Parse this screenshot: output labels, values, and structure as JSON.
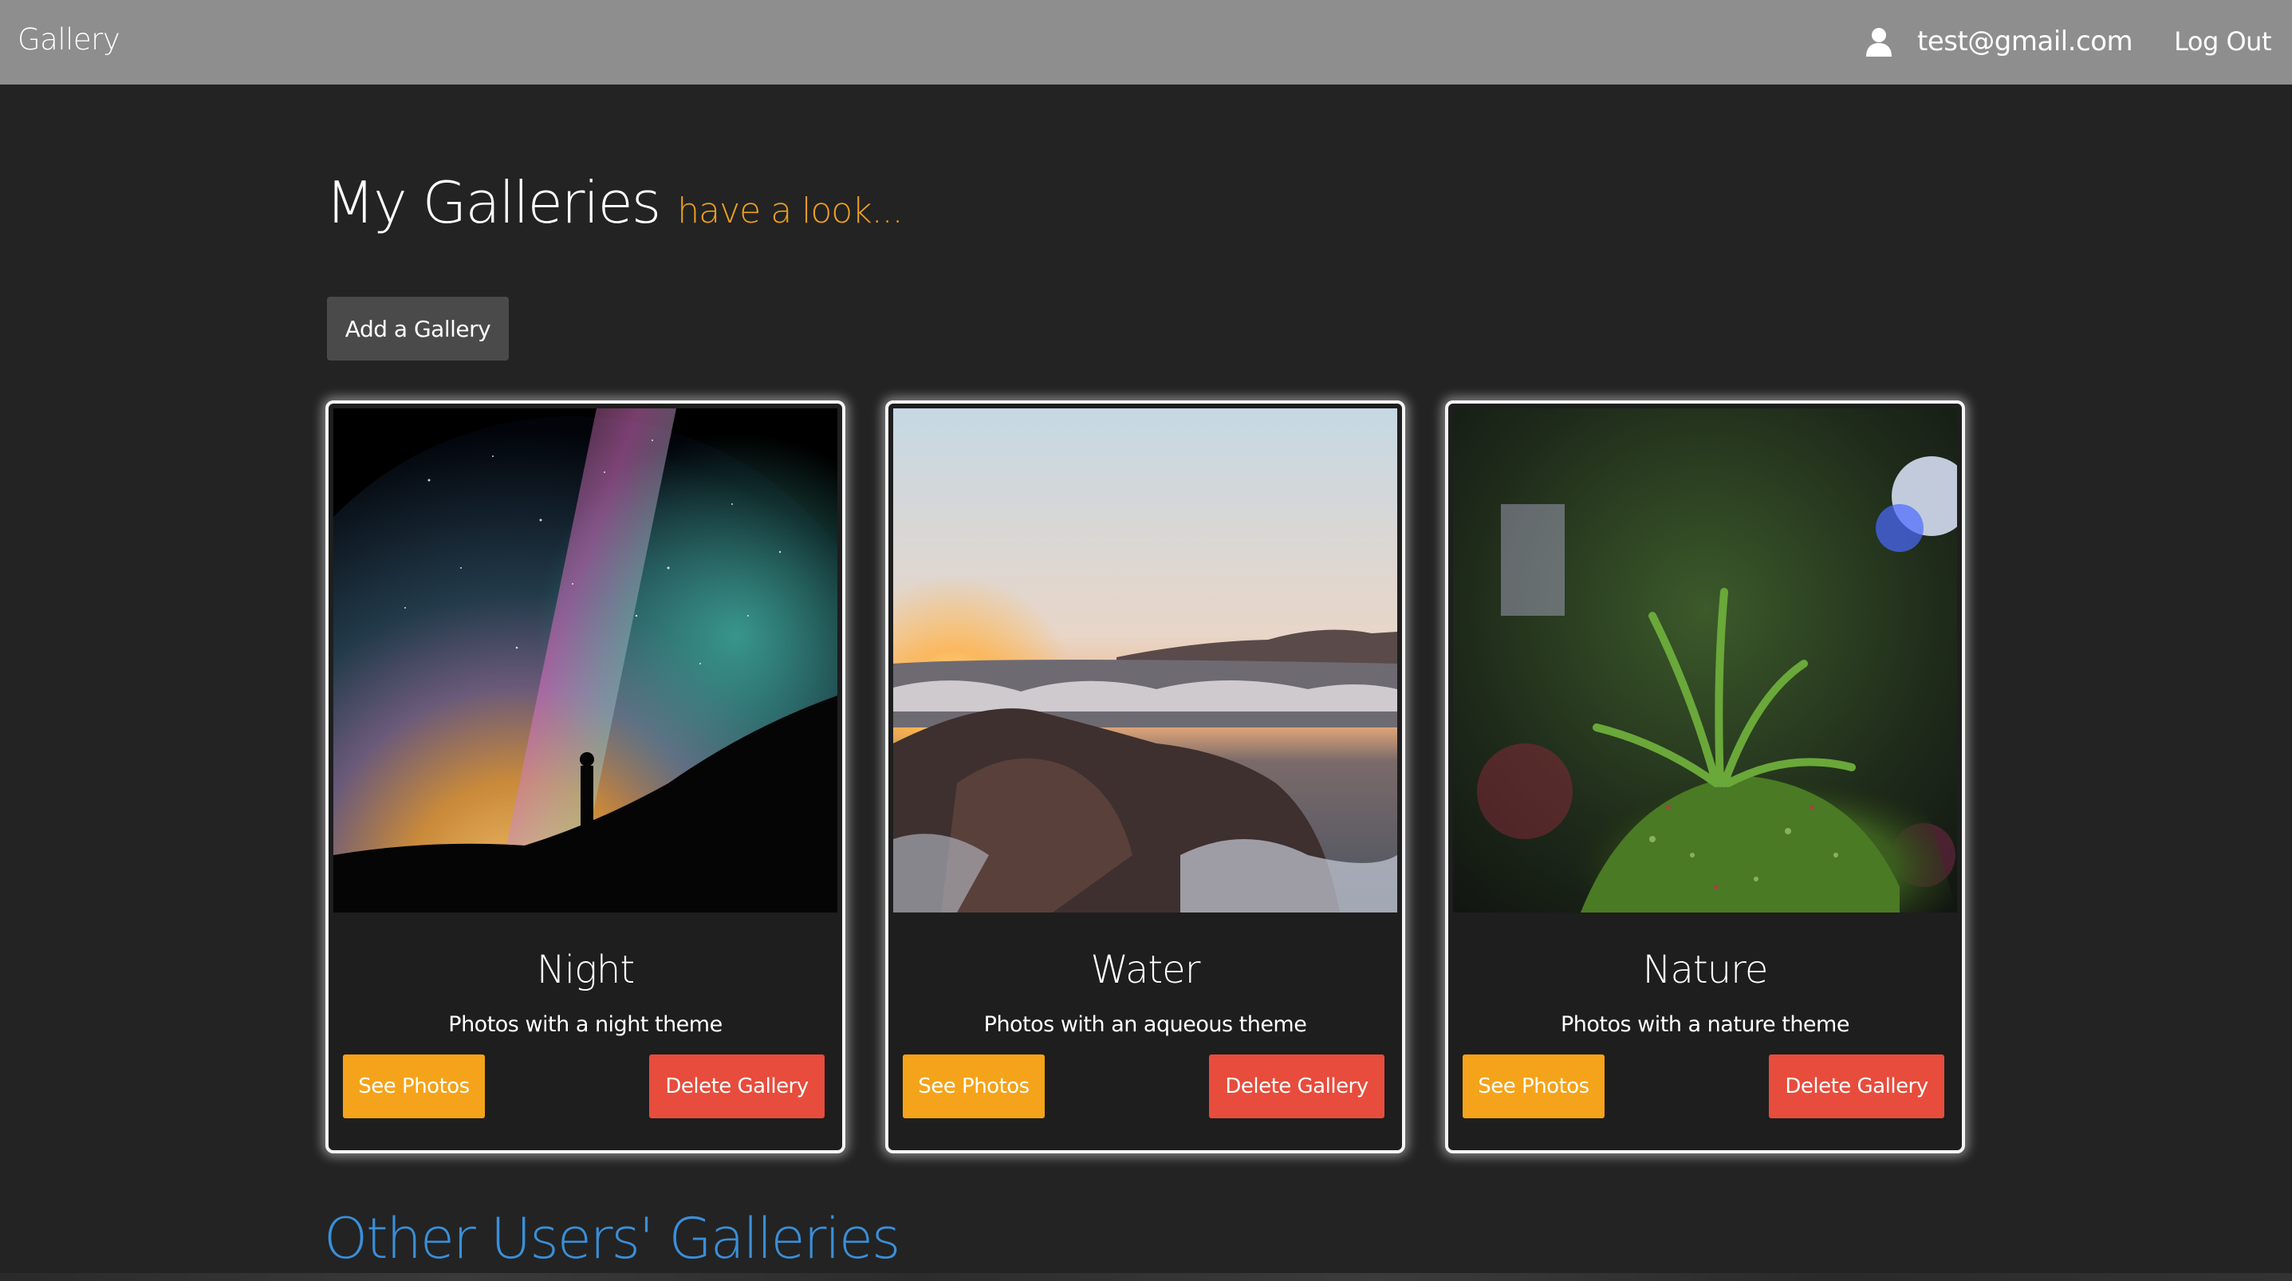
{
  "navbar": {
    "brand": "Gallery",
    "user_icon": "user-icon",
    "user_email": "test@gmail.com",
    "logout_label": "Log Out"
  },
  "page": {
    "title": "My Galleries",
    "subtitle": "have a look...",
    "add_button_label": "Add a Gallery",
    "other_heading": "Other Users' Galleries"
  },
  "galleries": [
    {
      "title": "Night",
      "description": "Photos with a night theme",
      "see_label": "See Photos",
      "delete_label": "Delete Gallery"
    },
    {
      "title": "Water",
      "description": "Photos with an aqueous theme",
      "see_label": "See Photos",
      "delete_label": "Delete Gallery"
    },
    {
      "title": "Nature",
      "description": "Photos with a nature theme",
      "see_label": "See Photos",
      "delete_label": "Delete Gallery"
    }
  ],
  "colors": {
    "navbar": "#8e8e8e",
    "background": "#232323",
    "accent_subtitle": "#f0a020",
    "see_button": "#f5a31a",
    "delete_button": "#e74c3c",
    "other_heading": "#3a8fd8"
  }
}
